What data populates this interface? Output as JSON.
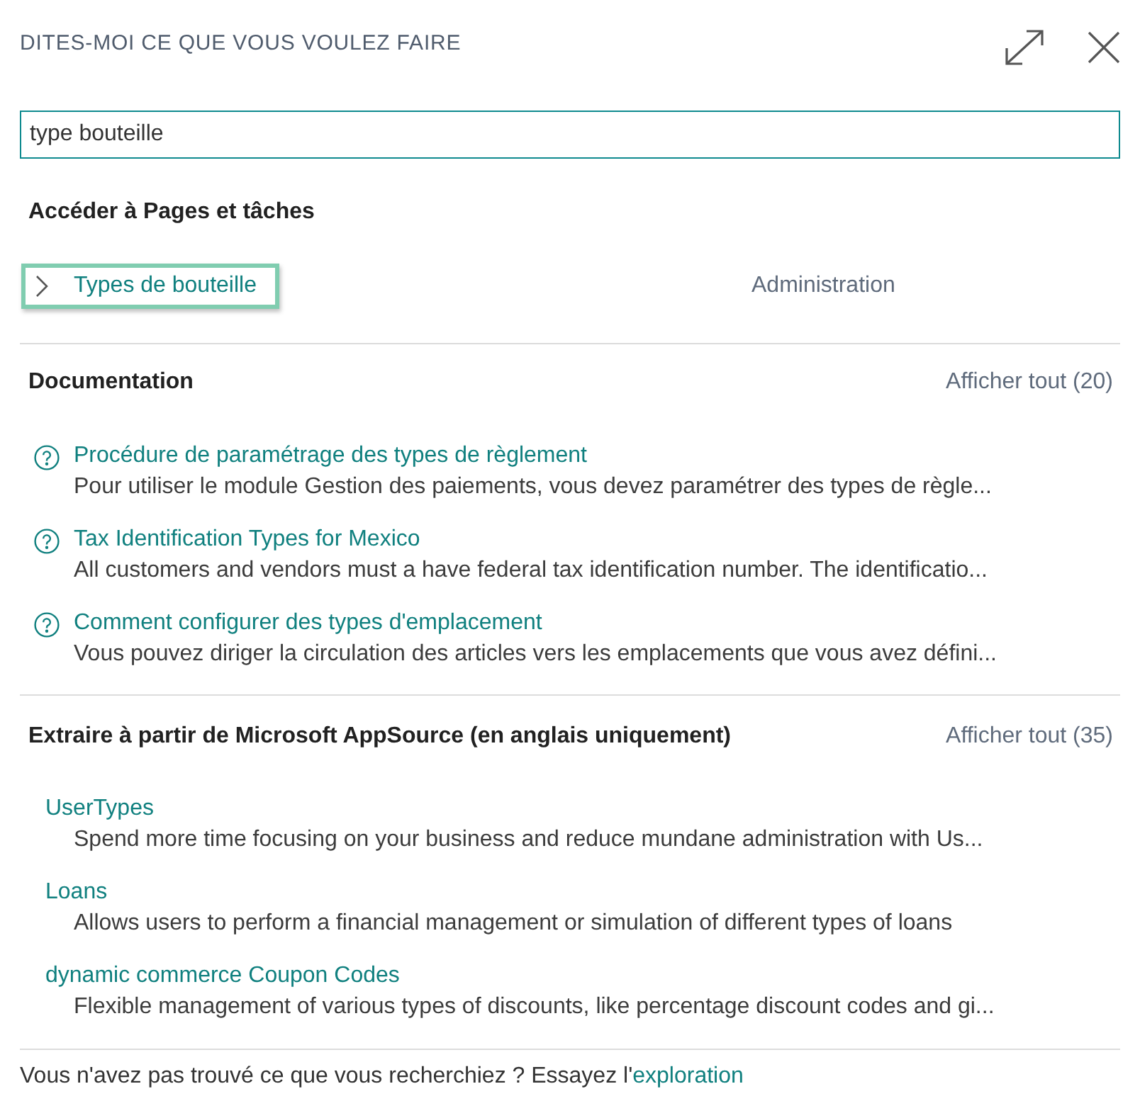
{
  "dialog": {
    "title": "DITES-MOI CE QUE VOUS VOULEZ FAIRE"
  },
  "search": {
    "value": "type bouteille"
  },
  "sections": [
    {
      "kind": "pages",
      "heading": "Accéder à Pages et tâches",
      "items": [
        {
          "title": "Types de bouteille",
          "category": "Administration",
          "selected": true
        }
      ]
    },
    {
      "kind": "docs",
      "heading": "Documentation",
      "show_all": "Afficher tout (20)",
      "items": [
        {
          "title": "Procédure de paramétrage des types de règlement",
          "description": "Pour utiliser le module Gestion des paiements, vous devez paramétrer des types de règle..."
        },
        {
          "title": "Tax Identification Types for Mexico",
          "description": "All customers and vendors must a have federal tax identification number. The identificatio..."
        },
        {
          "title": "Comment configurer des types d'emplacement",
          "description": "Vous pouvez diriger la circulation des articles vers les emplacements que vous avez défini..."
        }
      ]
    },
    {
      "kind": "apps",
      "heading": "Extraire à partir de Microsoft AppSource (en anglais uniquement)",
      "show_all": "Afficher tout (35)",
      "items": [
        {
          "title": "UserTypes",
          "description": "Spend more time focusing on your business and reduce mundane administration with Us..."
        },
        {
          "title": "Loans",
          "description": "Allows users to perform a financial management or simulation of different types of loans"
        },
        {
          "title": "dynamic commerce Coupon Codes",
          "description": "Flexible management of various types of discounts, like percentage discount codes and gi..."
        }
      ]
    }
  ],
  "footer": {
    "text": "Vous n'avez pas trouvé ce que vous recherchiez ? Essayez l'",
    "link": "exploration"
  }
}
